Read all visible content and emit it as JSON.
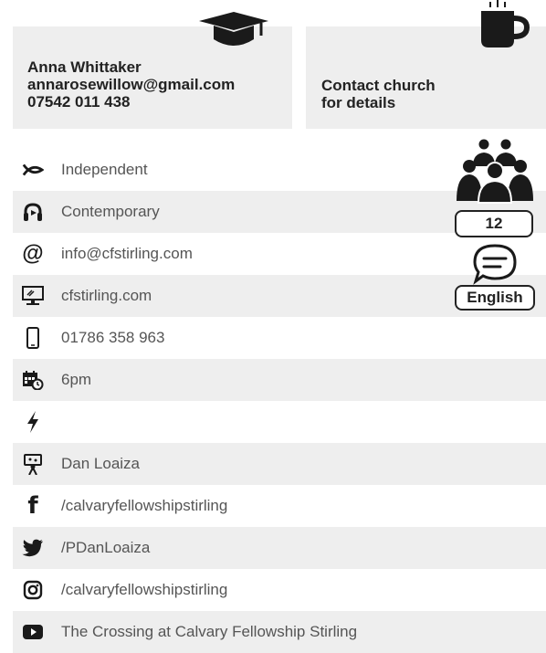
{
  "contact_card": {
    "name": "Anna Whittaker",
    "email": "annarosewillow@gmail.com",
    "phone": "07542 011 438",
    "icon": "graduation-cap-icon"
  },
  "coffee_card": {
    "line1": "Contact church",
    "line2": "for details",
    "icon": "coffee-cup-icon"
  },
  "details": [
    {
      "icon": "ichthys-fish-icon",
      "text": "Independent"
    },
    {
      "icon": "headphones-icon",
      "text": "Contemporary"
    },
    {
      "icon": "at-sign-icon",
      "text": "info@cfstirling.com"
    },
    {
      "icon": "desktop-monitor-icon",
      "text": "cfstirling.com"
    },
    {
      "icon": "mobile-phone-icon",
      "text": "01786 358 963"
    },
    {
      "icon": "calendar-clock-icon",
      "text": "6pm"
    },
    {
      "icon": "lightning-bolt-icon",
      "text": ""
    },
    {
      "icon": "children-ministry-icon",
      "text": "Dan Loaiza"
    },
    {
      "icon": "facebook-icon",
      "text": "/calvaryfellowshipstirling"
    },
    {
      "icon": "twitter-icon",
      "text": "/PDanLoaiza"
    },
    {
      "icon": "instagram-icon",
      "text": "/calvaryfellowshipstirling"
    },
    {
      "icon": "youtube-icon",
      "text": "The Crossing at Calvary Fellowship Stirling"
    }
  ],
  "side": {
    "attendance_icon": "people-group-icon",
    "attendance_count": "12",
    "language_icon": "speech-bubble-icon",
    "language": "English"
  }
}
